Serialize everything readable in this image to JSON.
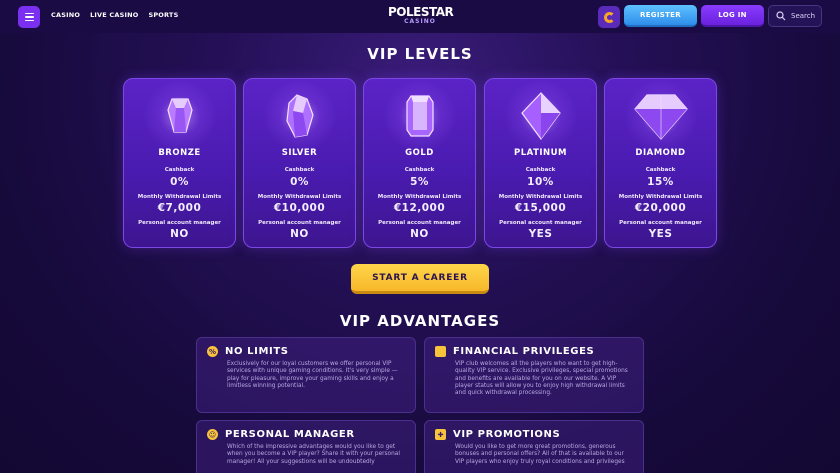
{
  "header": {
    "nav": [
      "CASINO",
      "LIVE CASINO",
      "SPORTS"
    ],
    "logo_main": "POLESTAR",
    "logo_sub": "CASINO",
    "register_label": "REGISTER",
    "login_label": "LOG IN",
    "search_label": "Search"
  },
  "levels": {
    "title": "VIP LEVELS",
    "labels": {
      "cashback": "Cashback",
      "withdrawal": "Monthly Withdrawal Limits",
      "manager": "Personal account manager"
    },
    "cards": [
      {
        "tier": "BRONZE",
        "cashback": "0%",
        "withdrawal": "€7,000",
        "manager": "NO"
      },
      {
        "tier": "SILVER",
        "cashback": "0%",
        "withdrawal": "€10,000",
        "manager": "NO"
      },
      {
        "tier": "GOLD",
        "cashback": "5%",
        "withdrawal": "€12,000",
        "manager": "NO"
      },
      {
        "tier": "PLATINUM",
        "cashback": "10%",
        "withdrawal": "€15,000",
        "manager": "YES"
      },
      {
        "tier": "DIAMOND",
        "cashback": "15%",
        "withdrawal": "€20,000",
        "manager": "YES"
      }
    ]
  },
  "cta_label": "START A CAREER",
  "advantages": {
    "title": "VIP ADVANTAGES",
    "items": [
      {
        "title": "NO LIMITS",
        "text": "Exclusively for our loyal customers we offer personal VIP services with unique gaming conditions. It's very simple — play for pleasure, improve your gaming skills and enjoy a limitless winning potential."
      },
      {
        "title": "FINANCIAL PRIVILEGES",
        "text": "VIP club welcomes all the players who want to get high-quality VIP service. Exclusive privileges, special promotions and benefits are available for you on our website. A VIP player status will allow you to enjoy high withdrawal limits and quick withdrawal processing."
      },
      {
        "title": "PERSONAL MANAGER",
        "text": "Which of the impressive advantages would you like to get when you become a VIP player? Share it with your personal manager! All your suggestions will be undoubtedly"
      },
      {
        "title": "VIP PROMOTIONS",
        "text": "Would you like to get more great promotions, generous bonuses and personal offers? All of that is available to our VIP players who enjoy truly royal conditions and privileges"
      }
    ]
  },
  "colors": {
    "accent_purple": "#7b2ff0",
    "register_blue": "#3aa0f5",
    "cta_yellow": "#f9c53a",
    "background": "#1a0b44"
  }
}
